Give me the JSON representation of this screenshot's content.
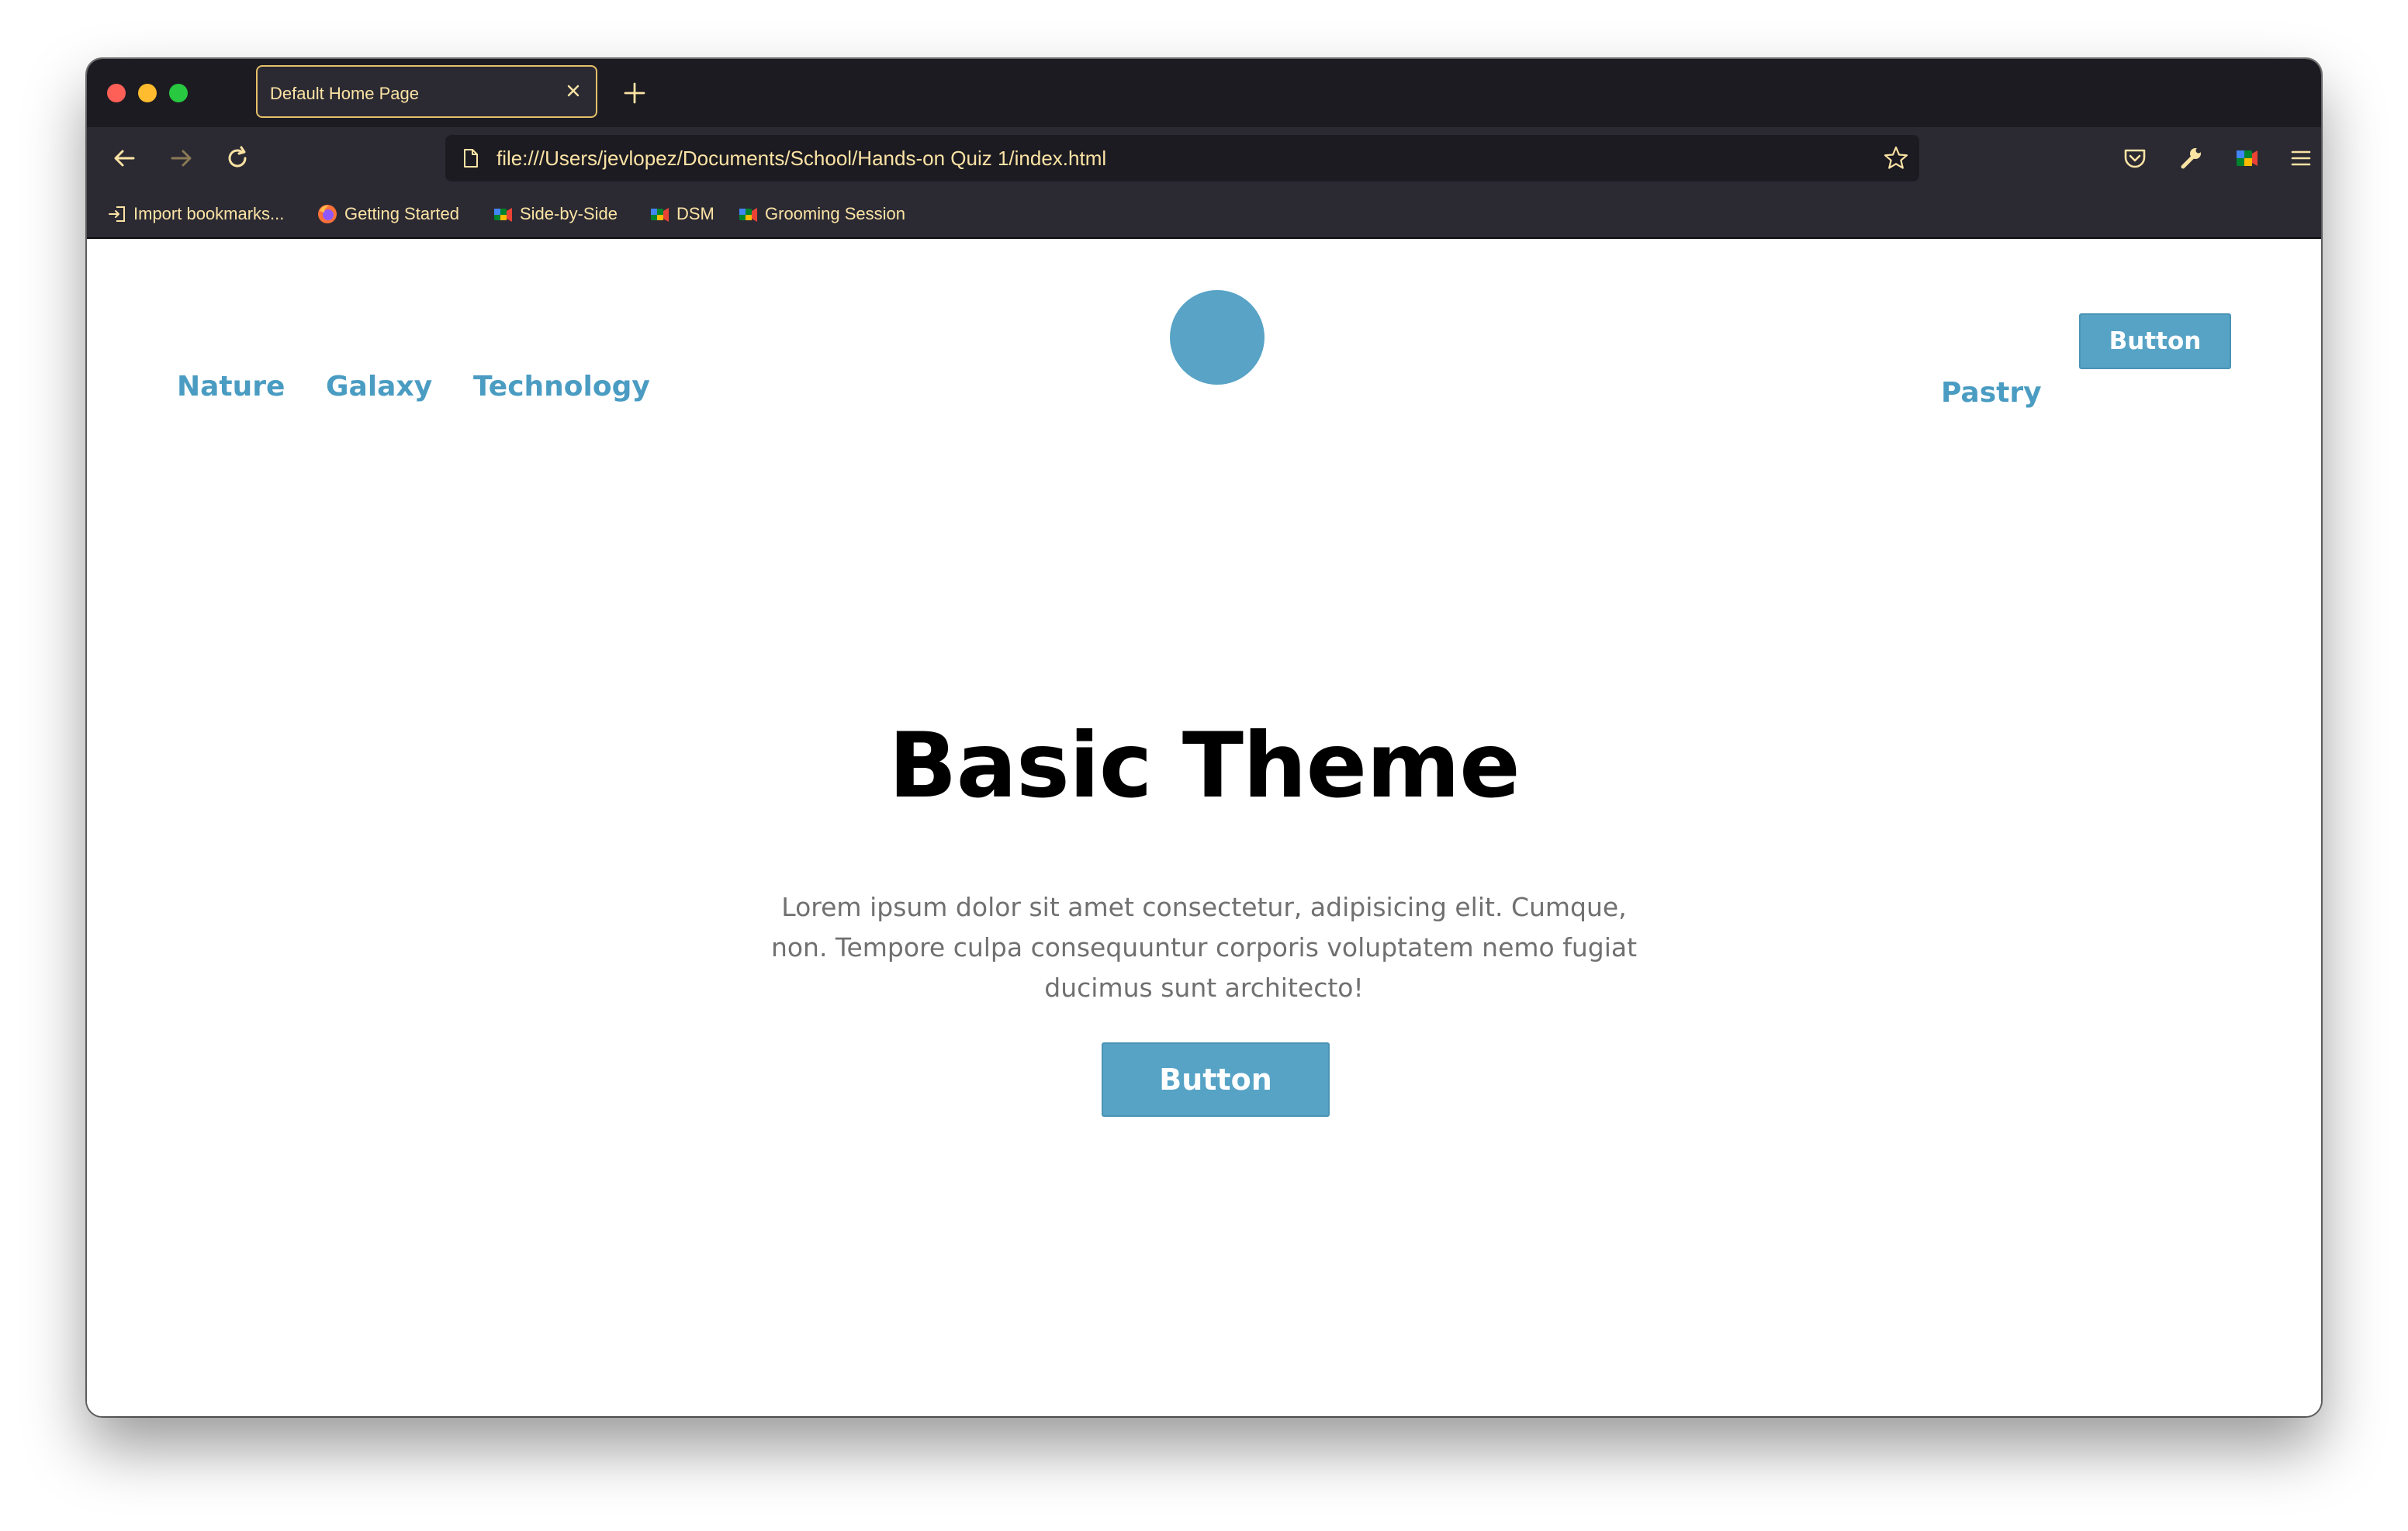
{
  "browser": {
    "tab": {
      "title": "Default Home Page"
    },
    "url": "file:///Users/jevlopez/Documents/School/Hands-on Quiz 1/index.html",
    "bookmarks": [
      {
        "label": "Import bookmarks...",
        "icon": "import-icon"
      },
      {
        "label": "Getting Started",
        "icon": "firefox-icon"
      },
      {
        "label": "Side-by-Side",
        "icon": "colorful-app-icon"
      },
      {
        "label": "DSM",
        "icon": "colorful-app-icon"
      },
      {
        "label": "Grooming Session",
        "icon": "colorful-app-icon"
      }
    ],
    "colors": {
      "chrome_dark": "#1c1b22",
      "toolbar": "#2b2a33",
      "accent_text": "#fbe3a4",
      "tab_border": "#e5c06a"
    }
  },
  "site": {
    "nav_left": [
      "Nature",
      "Galaxy",
      "Technology"
    ],
    "nav_right_link": "Pastry",
    "header_button": "Button",
    "hero": {
      "title": "Basic Theme",
      "text": "Lorem ipsum dolor sit amet consectetur, adipisicing elit. Cumque, non. Tempore culpa consequuntur corporis voluptatem nemo fugiat ducimus sunt architecto!",
      "button": "Button"
    },
    "colors": {
      "brand": "#56a3c6",
      "link": "#4a9cc2",
      "title": "#000000",
      "body_text": "#707070"
    }
  }
}
